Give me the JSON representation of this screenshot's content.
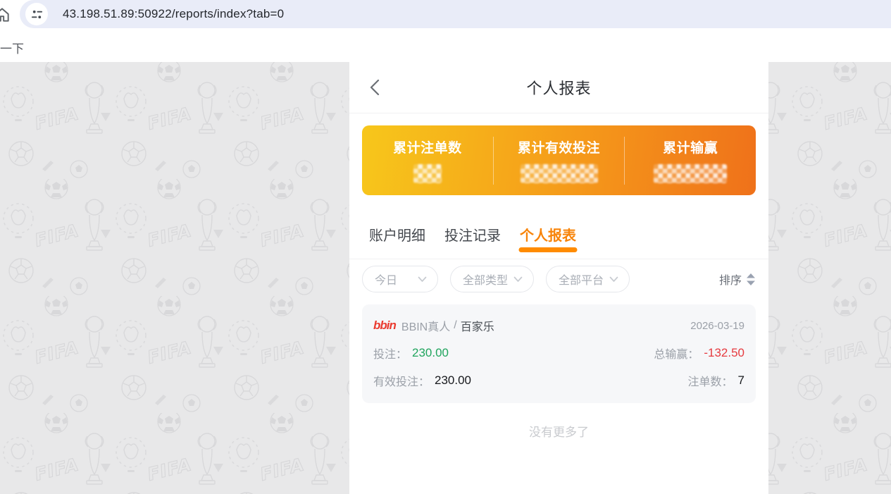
{
  "browser": {
    "url": "43.198.51.89:50922/reports/index?tab=0"
  },
  "page": {
    "top_fragment": "一下",
    "header": {
      "title": "个人报表"
    },
    "summary": {
      "stats": [
        {
          "label": "累计注单数",
          "masked": true
        },
        {
          "label": "累计有效投注",
          "masked": true
        },
        {
          "label": "累计输赢",
          "masked": true
        }
      ]
    },
    "tabs": [
      {
        "label": "账户明细",
        "active": false
      },
      {
        "label": "投注记录",
        "active": false
      },
      {
        "label": "个人报表",
        "active": true
      }
    ],
    "filters": [
      {
        "label": "今日"
      },
      {
        "label": "全部类型"
      },
      {
        "label": "全部平台"
      }
    ],
    "sort_label": "排序",
    "records": [
      {
        "provider_logo": "bbin",
        "provider": "BBIN真人",
        "separator": "/",
        "game": "百家乐",
        "date": "2026-03-19",
        "bet_label": "投注：",
        "bet_value": "230.00",
        "winloss_label": "总输赢：",
        "winloss_value": "-132.50",
        "valid_bet_label": "有效投注：",
        "valid_bet_value": "230.00",
        "count_label": "注单数：",
        "count_value": "7"
      }
    ],
    "end_text": "没有更多了"
  },
  "colors": {
    "accent_orange": "#ff8b00",
    "card_gradient_start": "#f7c71b",
    "card_gradient_end": "#ef711a",
    "positive_green": "#21a55e",
    "negative_red": "#e63a3f"
  }
}
